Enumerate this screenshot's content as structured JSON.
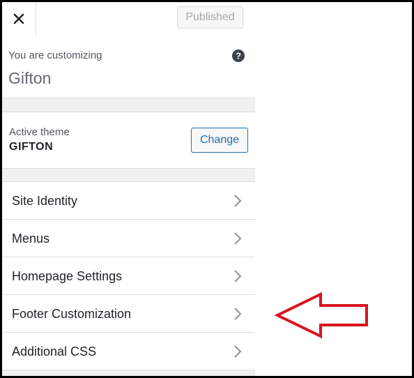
{
  "header": {
    "close_icon": "close-icon",
    "published_label": "Published"
  },
  "info": {
    "customizing_label": "You are customizing",
    "site_name": "Gifton",
    "help_icon": "help-icon"
  },
  "theme": {
    "label": "Active theme",
    "name": "GIFTON",
    "change_label": "Change"
  },
  "menu": {
    "items": [
      {
        "label": "Site Identity"
      },
      {
        "label": "Menus"
      },
      {
        "label": "Homepage Settings"
      },
      {
        "label": "Footer Customization"
      },
      {
        "label": "Additional CSS"
      }
    ],
    "chevron_icon": "chevron-right-icon"
  },
  "annotation": {
    "icon": "left-arrow-icon",
    "color": "#d9141e",
    "target": "Footer Customization"
  },
  "colors": {
    "panel_bg": "#f0f0f1",
    "border": "#dcdcde",
    "accent": "#2271b1"
  }
}
